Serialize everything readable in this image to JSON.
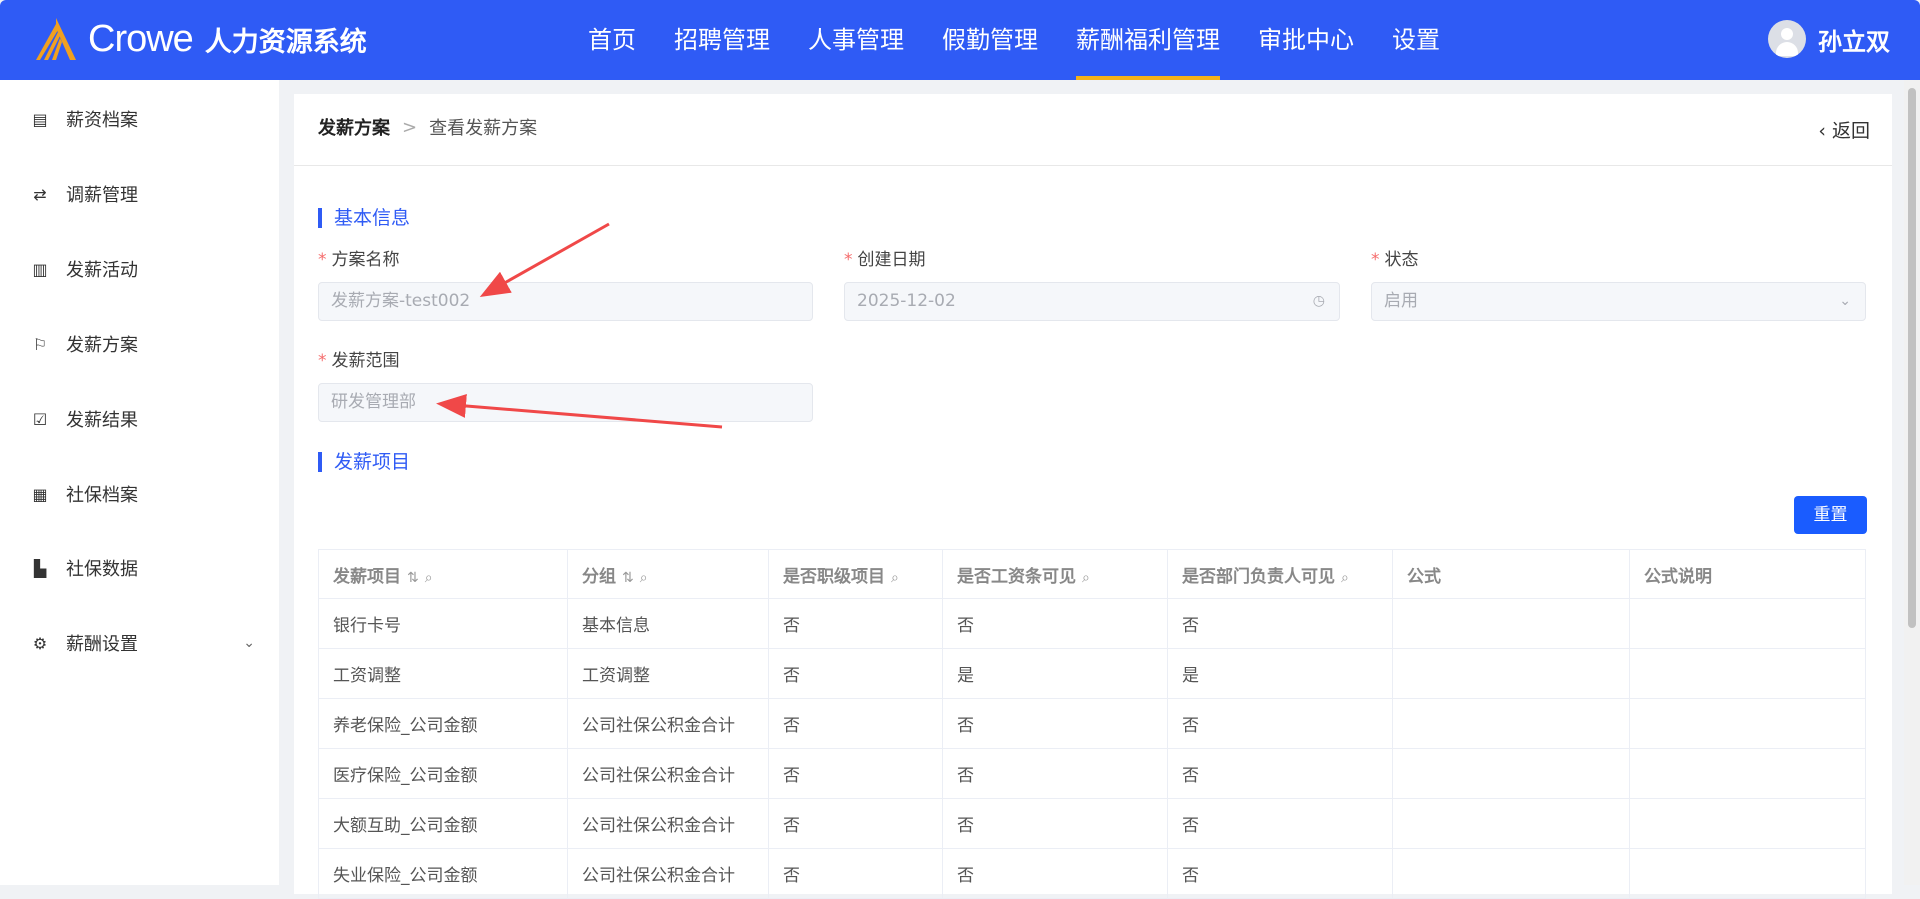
{
  "header": {
    "brand": "Crowe",
    "system": "人力资源系统",
    "nav": [
      "首页",
      "招聘管理",
      "人事管理",
      "假勤管理",
      "薪酬福利管理",
      "审批中心",
      "设置"
    ],
    "active_nav": "薪酬福利管理",
    "user": "孙立双"
  },
  "sidebar": {
    "items": [
      {
        "label": "薪资档案",
        "icon": "document-icon"
      },
      {
        "label": "调薪管理",
        "icon": "exchange-icon"
      },
      {
        "label": "发薪活动",
        "icon": "clipboard-icon"
      },
      {
        "label": "发薪方案",
        "icon": "flag-icon"
      },
      {
        "label": "发薪结果",
        "icon": "check-clipboard-icon"
      },
      {
        "label": "社保档案",
        "icon": "grid-icon"
      },
      {
        "label": "社保数据",
        "icon": "bar-chart-icon"
      },
      {
        "label": "薪酬设置",
        "icon": "gear-icon"
      }
    ]
  },
  "breadcrumb": {
    "parent": "发薪方案",
    "sep": ">",
    "current": "查看发薪方案"
  },
  "back": "‹ 返回",
  "basic": {
    "title": "基本信息",
    "fields": {
      "name": {
        "label": "方案名称",
        "value": "发薪方案-test002"
      },
      "date": {
        "label": "创建日期",
        "value": "2025-12-02"
      },
      "status": {
        "label": "状态",
        "value": "启用"
      },
      "scope": {
        "label": "发薪范围",
        "value": "研发管理部"
      }
    },
    "required_mark": "*"
  },
  "items": {
    "title": "发薪项目",
    "reset": "重置",
    "columns": [
      "发薪项目",
      "分组",
      "是否职级项目",
      "是否工资条可见",
      "是否部门负责人可见",
      "公式",
      "公式说明"
    ],
    "rows": [
      [
        "银行卡号",
        "基本信息",
        "否",
        "否",
        "否",
        "",
        ""
      ],
      [
        "工资调整",
        "工资调整",
        "否",
        "是",
        "是",
        "",
        ""
      ],
      [
        "养老保险_公司金额",
        "公司社保公积金合计",
        "否",
        "否",
        "否",
        "",
        ""
      ],
      [
        "医疗保险_公司金额",
        "公司社保公积金合计",
        "否",
        "否",
        "否",
        "",
        ""
      ],
      [
        "大额互助_公司金额",
        "公司社保公积金合计",
        "否",
        "否",
        "否",
        "",
        ""
      ],
      [
        "失业保险_公司金额",
        "公司社保公积金合计",
        "否",
        "否",
        "否",
        "",
        ""
      ]
    ]
  },
  "colors": {
    "primary": "#2f5bf5",
    "accent": "#f5b21a",
    "annotation": "#f04848"
  }
}
